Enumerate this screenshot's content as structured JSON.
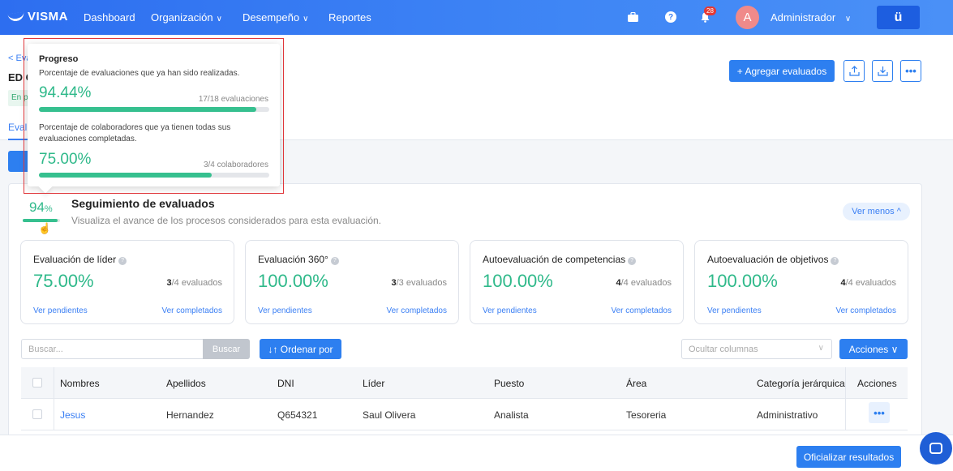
{
  "nav": {
    "logo": "VISMA",
    "items": [
      {
        "label": "Dashboard",
        "chevron": false
      },
      {
        "label": "Organización",
        "chevron": true
      },
      {
        "label": "Desempeño",
        "chevron": true
      },
      {
        "label": "Reportes",
        "chevron": false
      }
    ],
    "notification_count": "28",
    "avatar_letter": "A",
    "user_name": "Administrador",
    "app_label": "ü"
  },
  "header": {
    "back_link": "< Eva",
    "title_fragment": "ED C",
    "tag_fragment": "En p",
    "tab_fragment": "Evalu",
    "add_button": "+ Agregar evaluados"
  },
  "tooltip": {
    "title": "Progreso",
    "items": [
      {
        "description": "Porcentaje de evaluaciones que ya han sido realizadas.",
        "percent": "94.44%",
        "count": "17/18 evaluaciones",
        "fill": 0.9444
      },
      {
        "description": "Porcentaje de colaboradores que ya tienen todas sus evaluaciones completadas.",
        "percent": "75.00%",
        "count": "3/4 colaboradores",
        "fill": 0.75
      }
    ]
  },
  "tracking": {
    "mini_percent": "94",
    "mini_percent_sign": "%",
    "mini_fill": 0.94,
    "title": "Seguimiento de evaluados",
    "subtitle": "Visualiza el avance de los procesos considerados para esta evaluación.",
    "toggle_label": "Ver menos ^"
  },
  "stats": [
    {
      "title": "Evaluación de líder",
      "percent": "75.00%",
      "count_done": "3",
      "count_rest": "/4 evaluados",
      "pending": "Ver pendientes",
      "completed": "Ver completados"
    },
    {
      "title": "Evaluación 360°",
      "percent": "100.00%",
      "count_done": "3",
      "count_rest": "/3 evaluados",
      "pending": "Ver pendientes",
      "completed": "Ver completados"
    },
    {
      "title": "Autoevaluación de competencias",
      "percent": "100.00%",
      "count_done": "4",
      "count_rest": "/4 evaluados",
      "pending": "Ver pendientes",
      "completed": "Ver completados"
    },
    {
      "title": "Autoevaluación de objetivos",
      "percent": "100.00%",
      "count_done": "4",
      "count_rest": "/4 evaluados",
      "pending": "Ver pendientes",
      "completed": "Ver completados"
    }
  ],
  "toolbar": {
    "search_placeholder": "Buscar...",
    "search_button": "Buscar",
    "order_button": "↓↑ Ordenar por",
    "hide_columns_placeholder": "Ocultar columnas",
    "actions_button": "Acciones ∨"
  },
  "table": {
    "headers": [
      "Nombres",
      "Apellidos",
      "DNI",
      "Líder",
      "Puesto",
      "Área",
      "Categoría jerárquica",
      "Acciones"
    ],
    "rows": [
      [
        "Jesus",
        "Hernandez",
        "Q654321",
        "Saul Olivera",
        "Analista",
        "Tesoreria",
        "Administrativo"
      ]
    ]
  },
  "footer": {
    "officialize_button": "Oficializar resultados"
  },
  "colors": {
    "accent": "#2d7ff0",
    "success": "#2fb98a",
    "highlight": "#e0363a"
  }
}
